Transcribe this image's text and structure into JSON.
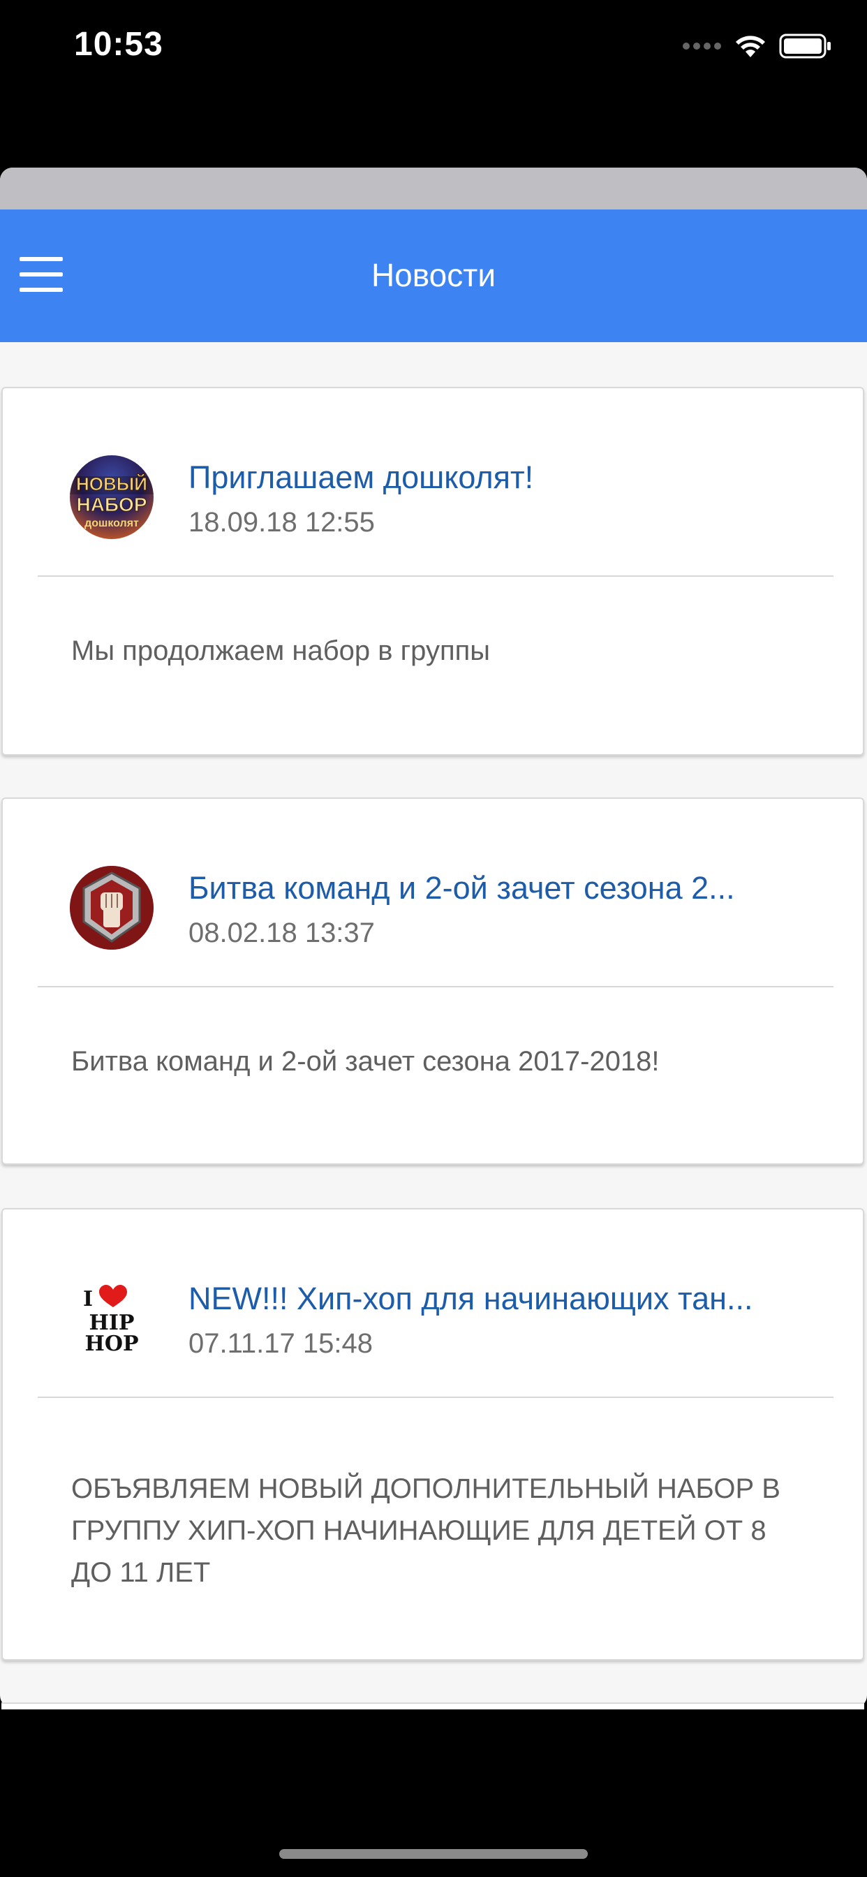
{
  "status_bar": {
    "time": "10:53"
  },
  "nav": {
    "title": "Новости",
    "menu_icon": "hamburger-menu-icon",
    "background_color": "#3d83f2"
  },
  "news": [
    {
      "title": "Приглашаем дошколят!",
      "date": "18.09.18 12:55",
      "body": "Мы продолжаем набор в группы",
      "avatar_text_top": "НОВЫЙ",
      "avatar_text_mid": "НАБОР",
      "avatar_text_bottom": "дошколят"
    },
    {
      "title": "Битва команд и 2-ой зачет сезона 2...",
      "date": "08.02.18 13:37",
      "body": "Битва команд и 2-ой зачет сезона 2017-2018!",
      "avatar_icon": "fist-emblem-icon"
    },
    {
      "title": "NEW!!! Хип-хоп для начинающих тан...",
      "date": "07.11.17 15:48",
      "body": "ОБЪЯВЛЯЕМ НОВЫЙ ДОПОЛНИТЕЛЬНЫЙ НАБОР В ГРУППУ ХИП-ХОП НАЧИНАЮЩИЕ ДЛЯ ДЕТЕЙ ОТ 8 ДО 11 ЛЕТ",
      "avatar_text_top": "I",
      "avatar_text_mid": "HIP",
      "avatar_text_bottom": "HOP"
    }
  ]
}
